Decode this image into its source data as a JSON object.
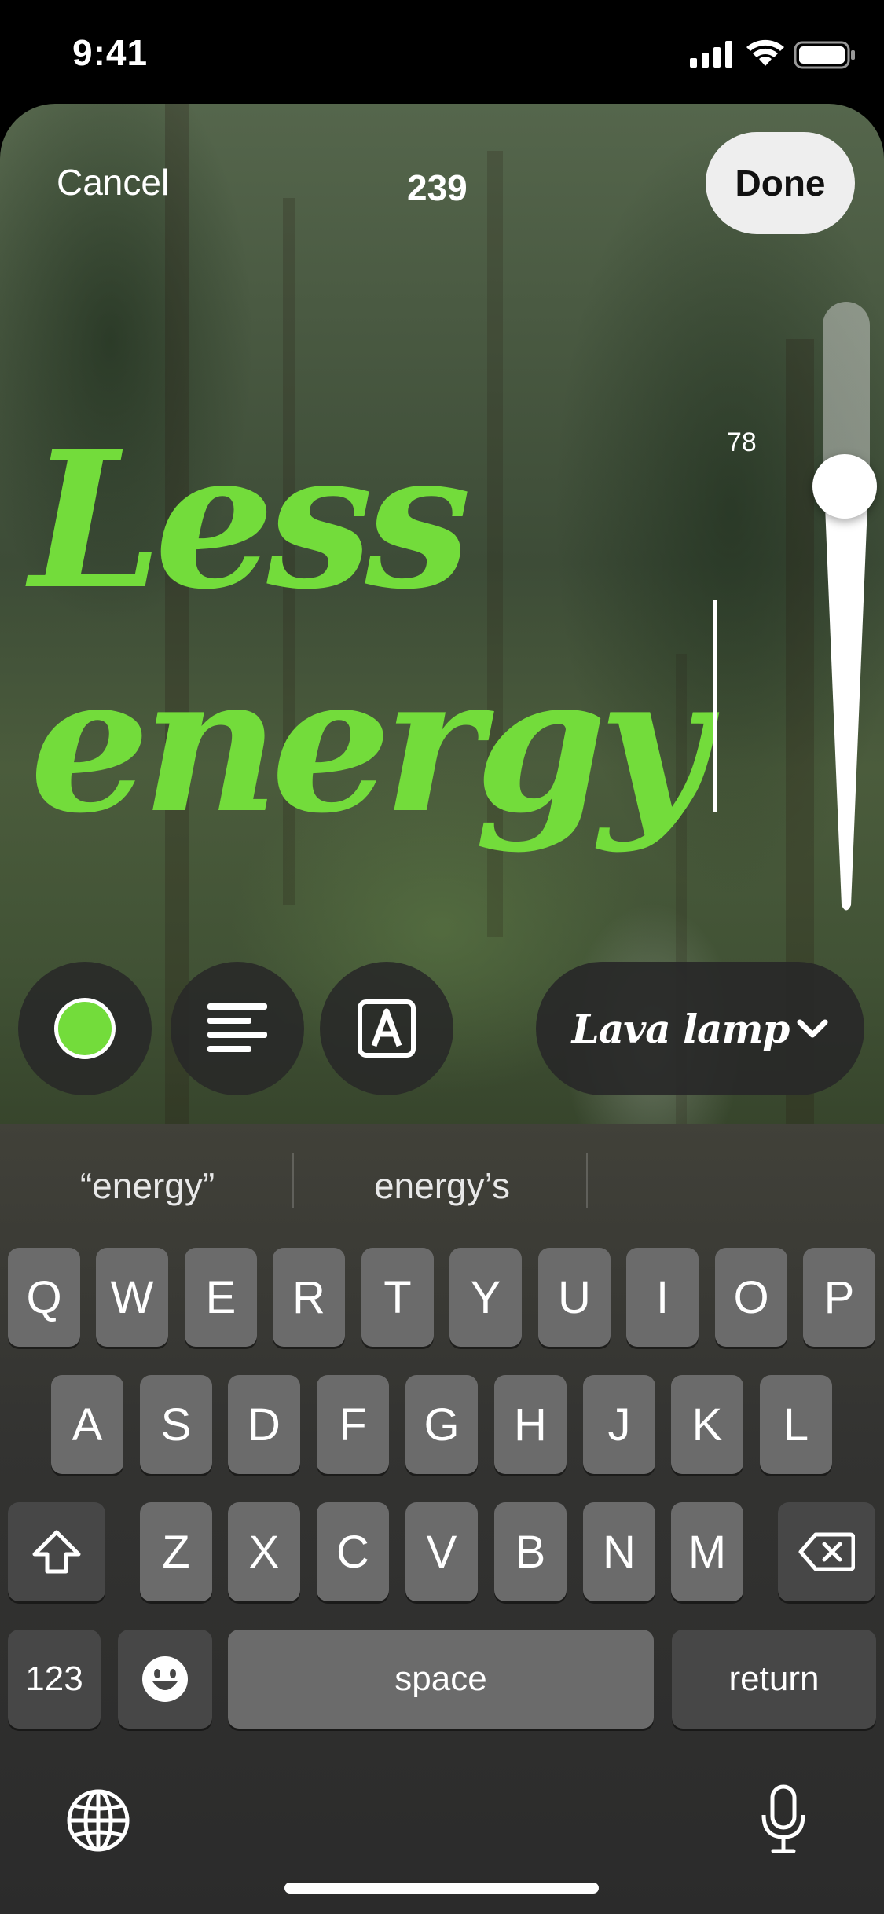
{
  "status_bar": {
    "time": "9:41"
  },
  "editor": {
    "cancel_label": "Cancel",
    "char_count": "239",
    "done_label": "Done",
    "size_value": "78",
    "size_level_fraction": 0.3,
    "headline_lines": [
      "Less",
      "energy"
    ],
    "text_color": "#73dc3b"
  },
  "toolbar": {
    "color_icon": "color-swatch-icon",
    "align_icon": "align-left-icon",
    "style_icon": "text-style-icon",
    "font_label": "Lava lamp",
    "font_chevron_icon": "chevron-down-icon"
  },
  "keyboard": {
    "predictions": [
      "“energy”",
      "energy’s"
    ],
    "row1": [
      "Q",
      "W",
      "E",
      "R",
      "T",
      "Y",
      "U",
      "I",
      "O",
      "P"
    ],
    "row2": [
      "A",
      "S",
      "D",
      "F",
      "G",
      "H",
      "J",
      "K",
      "L"
    ],
    "row3": [
      "Z",
      "X",
      "C",
      "V",
      "B",
      "N",
      "M"
    ],
    "numbers_label": "123",
    "space_label": "space",
    "return_label": "return",
    "shift_icon": "shift-icon",
    "delete_icon": "delete-icon",
    "emoji_icon": "emoji-icon",
    "globe_icon": "globe-icon",
    "mic_icon": "microphone-icon"
  }
}
